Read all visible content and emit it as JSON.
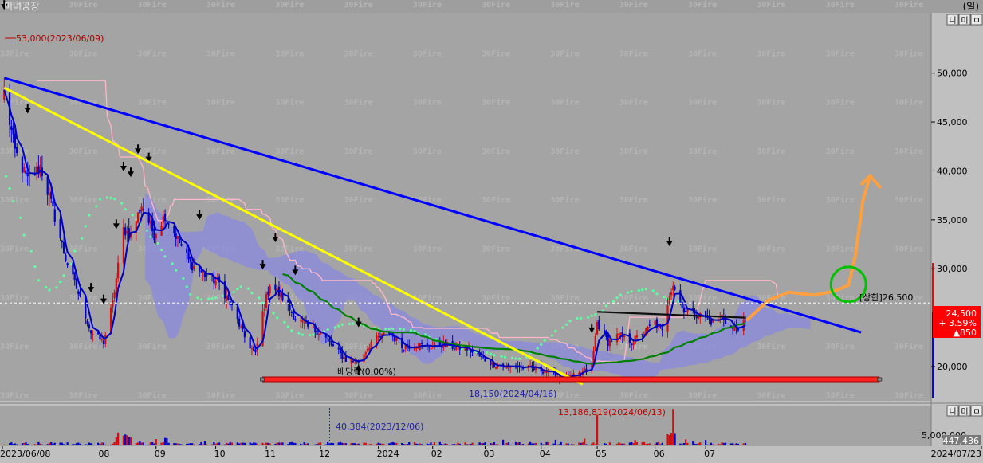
{
  "app": {
    "stock_name": "미녀공장",
    "period_label": "(일)",
    "watermark": "30Fire",
    "panel_buttons": [
      "니",
      "미",
      "ㅁ"
    ]
  },
  "chart_data": {
    "type": "candlestick",
    "price_axis": {
      "ylim": [
        16500,
        56000
      ],
      "ticks": [
        {
          "v": 50000,
          "label": "50,000"
        },
        {
          "v": 45000,
          "label": "45,000"
        },
        {
          "v": 40000,
          "label": "40,000"
        },
        {
          "v": 35000,
          "label": "35,000"
        },
        {
          "v": 30000,
          "label": "30,000"
        },
        {
          "v": 20000,
          "label": "20,000"
        }
      ]
    },
    "volume_axis": {
      "ylim": [
        0,
        13500000
      ],
      "tick_value": 5000000,
      "tick_label": "5,000,000"
    },
    "x_axis": {
      "start": "2023-06-08",
      "end": "2024-07-23",
      "labels": [
        {
          "date": "2023-06-08",
          "label": "2023/06/08"
        },
        {
          "date": "2023-08-01",
          "label": "08"
        },
        {
          "date": "2023-09-01",
          "label": "09"
        },
        {
          "date": "2023-10-04",
          "label": "10"
        },
        {
          "date": "2023-11-01",
          "label": "11"
        },
        {
          "date": "2023-12-01",
          "label": "12"
        },
        {
          "date": "2024-01-02",
          "label": "2024"
        },
        {
          "date": "2024-02-01",
          "label": "02"
        },
        {
          "date": "2024-03-01",
          "label": "03"
        },
        {
          "date": "2024-04-01",
          "label": "04"
        },
        {
          "date": "2024-05-02",
          "label": "05"
        },
        {
          "date": "2024-06-03",
          "label": "06"
        },
        {
          "date": "2024-07-01",
          "label": "07"
        },
        {
          "date": "2024-07-23",
          "label": "2024/07/23"
        }
      ]
    },
    "close_path": [
      [
        "2023-06-09",
        48000
      ],
      [
        "2023-06-15",
        42000
      ],
      [
        "2023-06-22",
        39000
      ],
      [
        "2023-06-29",
        40500
      ],
      [
        "2023-07-06",
        36000
      ],
      [
        "2023-07-13",
        31000
      ],
      [
        "2023-07-20",
        27500
      ],
      [
        "2023-07-27",
        23500
      ],
      [
        "2023-08-03",
        22500
      ],
      [
        "2023-08-08",
        26500
      ],
      [
        "2023-08-14",
        34000
      ],
      [
        "2023-08-18",
        33500
      ],
      [
        "2023-08-24",
        36500
      ],
      [
        "2023-08-31",
        33500
      ],
      [
        "2023-09-06",
        35500
      ],
      [
        "2023-09-13",
        33000
      ],
      [
        "2023-09-20",
        30500
      ],
      [
        "2023-09-27",
        29500
      ],
      [
        "2023-10-06",
        28500
      ],
      [
        "2023-10-13",
        26000
      ],
      [
        "2023-10-20",
        23000
      ],
      [
        "2023-10-26",
        21200
      ],
      [
        "2023-10-30",
        25500
      ],
      [
        "2023-11-03",
        28500
      ],
      [
        "2023-11-10",
        27000
      ],
      [
        "2023-11-17",
        25000
      ],
      [
        "2023-11-24",
        24000
      ],
      [
        "2023-12-01",
        23500
      ],
      [
        "2023-12-08",
        22000
      ],
      [
        "2023-12-15",
        20700
      ],
      [
        "2023-12-22",
        20500
      ],
      [
        "2023-12-29",
        22500
      ],
      [
        "2024-01-08",
        23500
      ],
      [
        "2024-01-15",
        22000
      ],
      [
        "2024-01-22",
        22300
      ],
      [
        "2024-01-29",
        22000
      ],
      [
        "2024-02-05",
        22300
      ],
      [
        "2024-02-13",
        22000
      ],
      [
        "2024-02-20",
        21800
      ],
      [
        "2024-02-27",
        21000
      ],
      [
        "2024-03-05",
        20300
      ],
      [
        "2024-03-12",
        20000
      ],
      [
        "2024-03-19",
        20000
      ],
      [
        "2024-03-26",
        19800
      ],
      [
        "2024-04-03",
        19600
      ],
      [
        "2024-04-10",
        19000
      ],
      [
        "2024-04-16",
        18800
      ],
      [
        "2024-04-22",
        19200
      ],
      [
        "2024-04-29",
        20000
      ],
      [
        "2024-05-02",
        24500
      ],
      [
        "2024-05-08",
        22500
      ],
      [
        "2024-05-14",
        23200
      ],
      [
        "2024-05-21",
        22500
      ],
      [
        "2024-05-28",
        23500
      ],
      [
        "2024-06-03",
        24500
      ],
      [
        "2024-06-07",
        23500
      ],
      [
        "2024-06-11",
        27500
      ],
      [
        "2024-06-13",
        28500
      ],
      [
        "2024-06-18",
        26000
      ],
      [
        "2024-06-24",
        25500
      ],
      [
        "2024-07-01",
        25000
      ],
      [
        "2024-07-05",
        24500
      ],
      [
        "2024-07-10",
        25200
      ],
      [
        "2024-07-16",
        23800
      ],
      [
        "2024-07-23",
        24500
      ]
    ],
    "trendlines": [
      {
        "color": "#0000ff",
        "from": [
          "2023-06-09",
          49500
        ],
        "to": [
          "2024-09-25",
          23500
        ]
      },
      {
        "color": "#ffff00",
        "from": [
          "2023-06-09",
          48500
        ],
        "to": [
          "2024-04-24",
          18200
        ]
      }
    ],
    "support_line": {
      "value": 18700,
      "from": "2023-10-30",
      "to": "2024-10-05"
    },
    "upper_limit_line": {
      "value": 26500,
      "label": "[상한]26,500"
    },
    "current": {
      "price": "24,500",
      "change_pct": "+ 3.59%",
      "change": "▲850"
    },
    "current_volume": "447,436",
    "annotations": {
      "high": "53,000(2023/06/09)",
      "low": "18,150(2024/04/16)",
      "dividend": "배당락(0.00%)",
      "volume_max": "13,186,819(2024/06/13)",
      "volume_min": "40,384(2023/12/06)"
    },
    "colors": {
      "background": "#a4a4a4",
      "up": "#d01010",
      "down": "#0000c8",
      "ma_line": "#0000c0",
      "long_ma": "#008000",
      "cloud": "#8a8ae0",
      "leading_span": "#ffb8c8",
      "lagging_span": "#60ffa0",
      "forecast": "#ffa040",
      "circle": "#00c000"
    }
  }
}
